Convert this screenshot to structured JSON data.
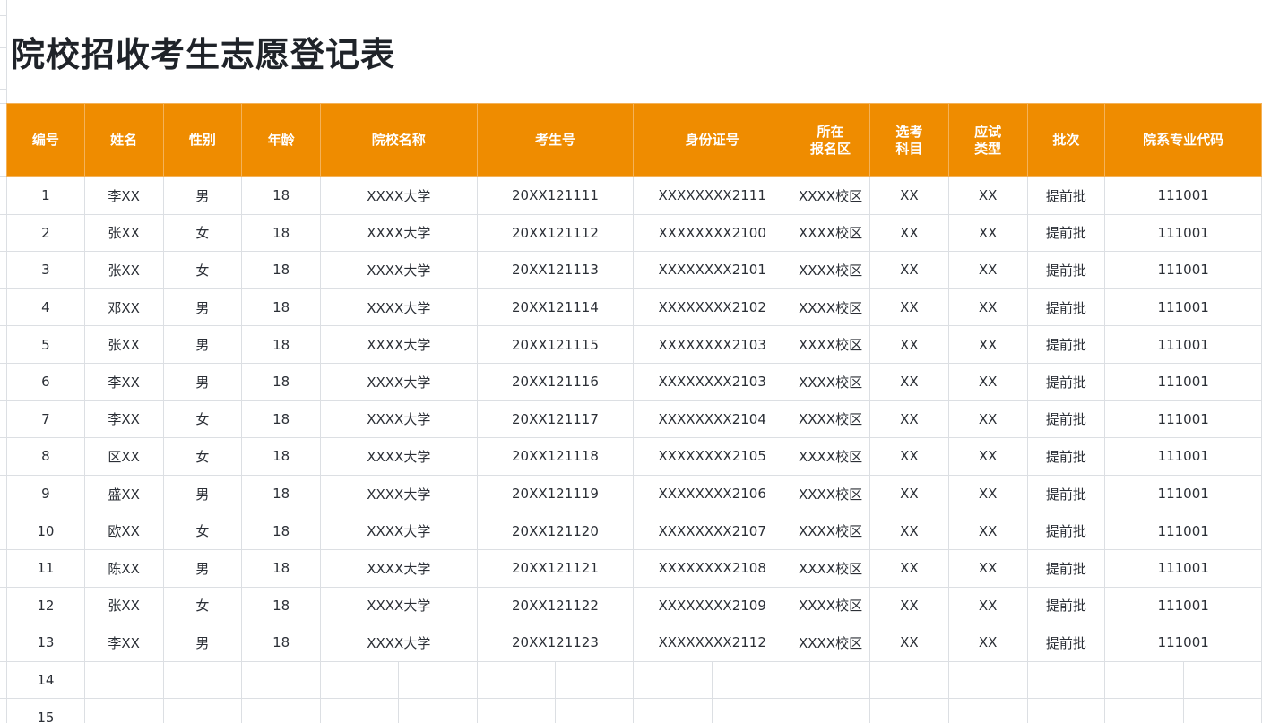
{
  "title": "院校招收考生志愿登记表",
  "colors": {
    "header_bg": "#ef8c00",
    "header_text": "#ffffff",
    "grid_line": "#dcdfe3"
  },
  "table": {
    "headers": [
      [
        "编号"
      ],
      [
        "姓名"
      ],
      [
        "性别"
      ],
      [
        "年龄"
      ],
      [
        "院校名称"
      ],
      [
        "考生号"
      ],
      [
        "身份证号"
      ],
      [
        "所在",
        "报名区"
      ],
      [
        "选考",
        "科目"
      ],
      [
        "应试",
        "类型"
      ],
      [
        "批次"
      ],
      [
        "院系专业代码"
      ]
    ],
    "rows": [
      [
        "1",
        "李XX",
        "男",
        "18",
        "XXXX大学",
        "20XX121111",
        "XXXXXXXX2111",
        "XXXX校区",
        "XX",
        "XX",
        "提前批",
        "111001"
      ],
      [
        "2",
        "张XX",
        "女",
        "18",
        "XXXX大学",
        "20XX121112",
        "XXXXXXXX2100",
        "XXXX校区",
        "XX",
        "XX",
        "提前批",
        "111001"
      ],
      [
        "3",
        "张XX",
        "女",
        "18",
        "XXXX大学",
        "20XX121113",
        "XXXXXXXX2101",
        "XXXX校区",
        "XX",
        "XX",
        "提前批",
        "111001"
      ],
      [
        "4",
        "邓XX",
        "男",
        "18",
        "XXXX大学",
        "20XX121114",
        "XXXXXXXX2102",
        "XXXX校区",
        "XX",
        "XX",
        "提前批",
        "111001"
      ],
      [
        "5",
        "张XX",
        "男",
        "18",
        "XXXX大学",
        "20XX121115",
        "XXXXXXXX2103",
        "XXXX校区",
        "XX",
        "XX",
        "提前批",
        "111001"
      ],
      [
        "6",
        "李XX",
        "男",
        "18",
        "XXXX大学",
        "20XX121116",
        "XXXXXXXX2103",
        "XXXX校区",
        "XX",
        "XX",
        "提前批",
        "111001"
      ],
      [
        "7",
        "李XX",
        "女",
        "18",
        "XXXX大学",
        "20XX121117",
        "XXXXXXXX2104",
        "XXXX校区",
        "XX",
        "XX",
        "提前批",
        "111001"
      ],
      [
        "8",
        "区XX",
        "女",
        "18",
        "XXXX大学",
        "20XX121118",
        "XXXXXXXX2105",
        "XXXX校区",
        "XX",
        "XX",
        "提前批",
        "111001"
      ],
      [
        "9",
        "盛XX",
        "男",
        "18",
        "XXXX大学",
        "20XX121119",
        "XXXXXXXX2106",
        "XXXX校区",
        "XX",
        "XX",
        "提前批",
        "111001"
      ],
      [
        "10",
        "欧XX",
        "女",
        "18",
        "XXXX大学",
        "20XX121120",
        "XXXXXXXX2107",
        "XXXX校区",
        "XX",
        "XX",
        "提前批",
        "111001"
      ],
      [
        "11",
        "陈XX",
        "男",
        "18",
        "XXXX大学",
        "20XX121121",
        "XXXXXXXX2108",
        "XXXX校区",
        "XX",
        "XX",
        "提前批",
        "111001"
      ],
      [
        "12",
        "张XX",
        "女",
        "18",
        "XXXX大学",
        "20XX121122",
        "XXXXXXXX2109",
        "XXXX校区",
        "XX",
        "XX",
        "提前批",
        "111001"
      ],
      [
        "13",
        "李XX",
        "男",
        "18",
        "XXXX大学",
        "20XX121123",
        "XXXXXXXX2112",
        "XXXX校区",
        "XX",
        "XX",
        "提前批",
        "111001"
      ]
    ],
    "empty_row_numbers": [
      "14",
      "15"
    ]
  }
}
